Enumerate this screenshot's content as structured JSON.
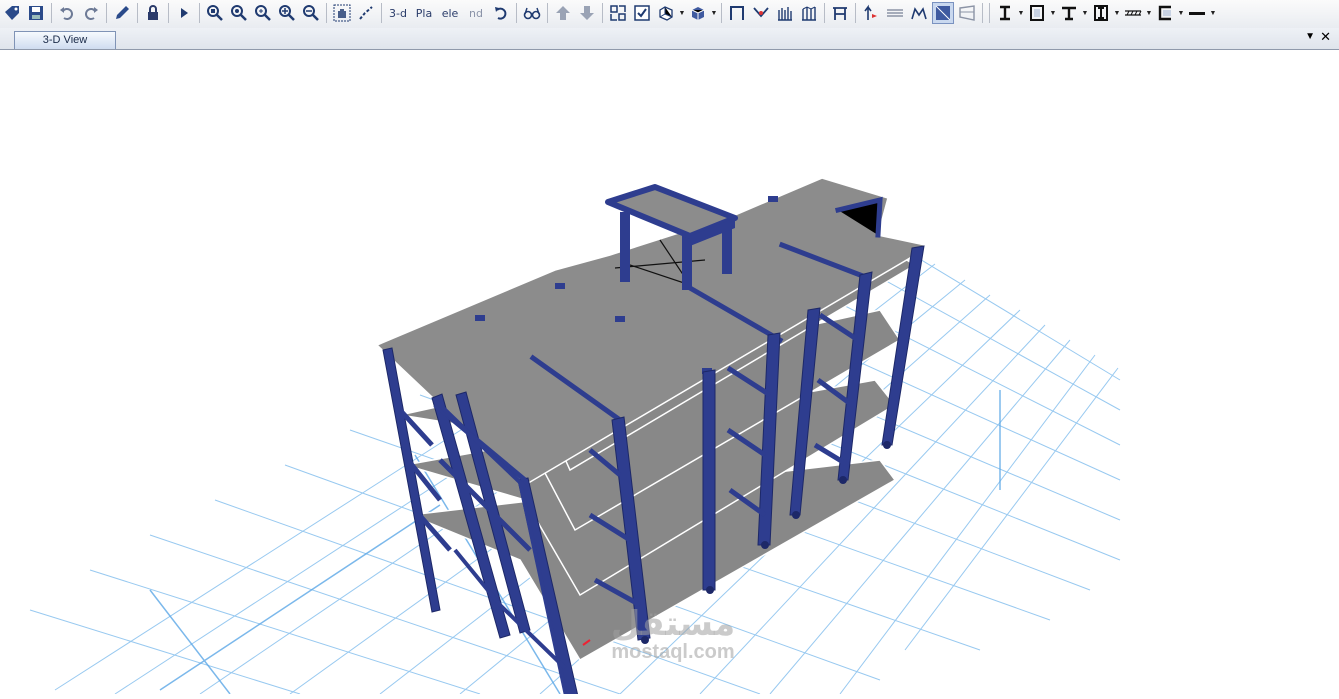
{
  "toolbar": {
    "text_buttons": {
      "view_3d": "3-d",
      "plan": "Pla",
      "elevation": "ele",
      "nd": "nd"
    },
    "icons": [
      "tag-icon",
      "save-icon",
      "undo-icon",
      "redo-icon",
      "pencil-icon",
      "lock-icon",
      "run-icon",
      "zoom-window-icon",
      "zoom-restore-icon",
      "zoom-fit-icon",
      "zoom-in-icon",
      "zoom-out-icon",
      "pan-icon",
      "rubber-band-icon",
      "rotate-icon",
      "glasses-icon",
      "up-arrow-icon",
      "down-arrow-icon",
      "select-icon",
      "checkbox-icon",
      "object-display-icon",
      "shaded-box-icon",
      "frame-icon",
      "release-icon",
      "bars-icon",
      "supports-icon",
      "frame-line-icon",
      "axis-icon",
      "strip-icon",
      "deformed-icon",
      "shaded-view-icon",
      "perspective-icon",
      "i-beam-icon",
      "rectangle-section-icon",
      "tee-section-icon",
      "wide-flange-icon",
      "hatch-icon",
      "channel-icon",
      "line-icon"
    ]
  },
  "tabs": {
    "active": "3-D View",
    "menu_glyph": "▼",
    "close_glyph": "✕"
  },
  "watermark": {
    "arabic": "مستقل",
    "latin": "mostaql.com"
  },
  "colors": {
    "frame": "#2e3d8f",
    "slab": "#8a8a8a",
    "grid": "#8fc3ee",
    "toolbar_icon": "#1f3a70"
  }
}
